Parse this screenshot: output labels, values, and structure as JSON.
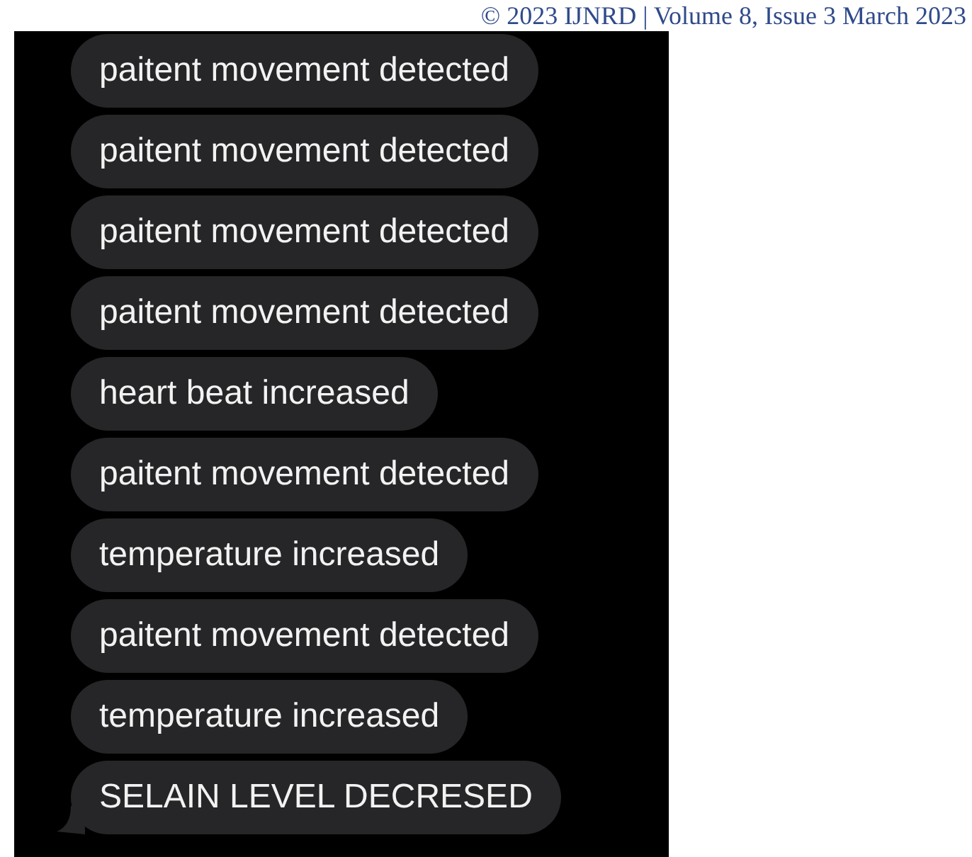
{
  "header": "© 2023 IJNRD | Volume 8, Issue 3 March 2023",
  "messages": [
    {
      "text": "paitent movement detected",
      "tail": false
    },
    {
      "text": "paitent movement detected",
      "tail": false
    },
    {
      "text": "paitent movement detected",
      "tail": false
    },
    {
      "text": "paitent movement detected",
      "tail": false
    },
    {
      "text": "heart beat increased",
      "tail": false
    },
    {
      "text": "paitent movement detected",
      "tail": false
    },
    {
      "text": "temperature increased",
      "tail": false
    },
    {
      "text": "paitent movement detected",
      "tail": false
    },
    {
      "text": "temperature increased",
      "tail": false
    },
    {
      "text": "SELAIN LEVEL DECRESED",
      "tail": true
    }
  ]
}
